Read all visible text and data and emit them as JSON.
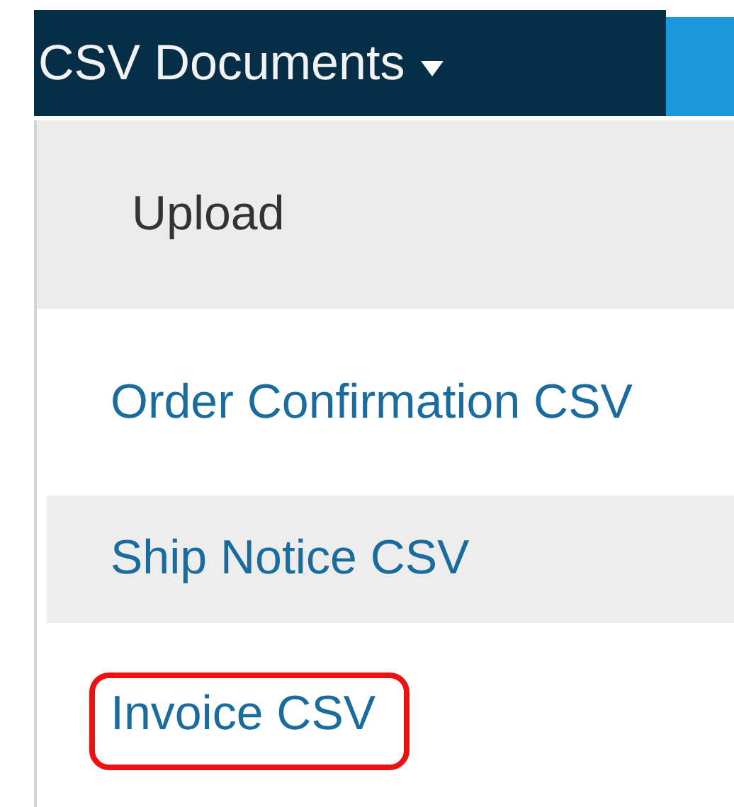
{
  "menu_button": {
    "label": "CSV Documents"
  },
  "menu": {
    "section": "Upload",
    "items": [
      {
        "label": "Order Confirmation CSV",
        "hovered": false,
        "highlighted": false
      },
      {
        "label": "Ship Notice CSV",
        "hovered": true,
        "highlighted": false
      },
      {
        "label": "Invoice CSV",
        "hovered": false,
        "highlighted": true
      }
    ]
  }
}
